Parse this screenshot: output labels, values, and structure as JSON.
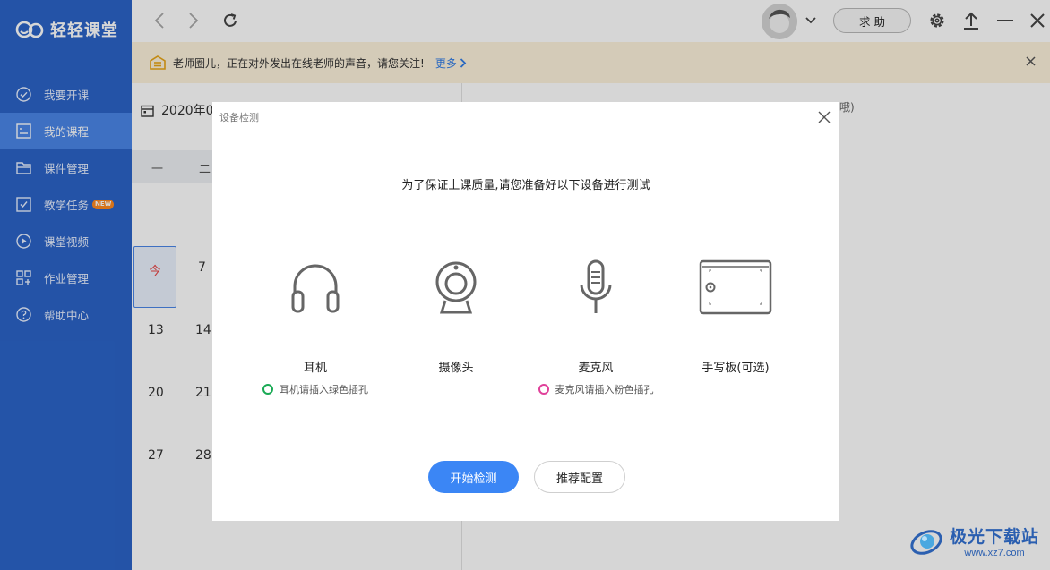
{
  "app": {
    "name": "轻轻课堂"
  },
  "sidebar": {
    "items": [
      {
        "label": "我要开课",
        "icon": "check-circle-icon"
      },
      {
        "label": "我的课程",
        "icon": "course-list-icon",
        "active": true
      },
      {
        "label": "课件管理",
        "icon": "folder-icon"
      },
      {
        "label": "教学任务",
        "icon": "task-check-icon",
        "badge": "NEW"
      },
      {
        "label": "课堂视频",
        "icon": "play-circle-icon"
      },
      {
        "label": "作业管理",
        "icon": "grid-icon"
      },
      {
        "label": "帮助中心",
        "icon": "question-circle-icon"
      }
    ]
  },
  "topbar": {
    "help_label": "求 助"
  },
  "notice": {
    "text": "老师圈儿，正在对外发出在线老师的声音，请您关注!",
    "more_label": "更多"
  },
  "calendar": {
    "month_label": "2020年0",
    "weekdays": [
      "一",
      "二"
    ],
    "today_label": "今",
    "days": [
      "7",
      "13",
      "14",
      "20",
      "21",
      "27",
      "28"
    ]
  },
  "background_hint": "哦)",
  "modal": {
    "title": "设备检测",
    "heading": "为了保证上课质量,请您准备好以下设备进行测试",
    "devices": [
      {
        "label": "耳机",
        "icon": "headphones-icon",
        "hint": "耳机请插入绿色插孔",
        "hint_color": "#1aaa55"
      },
      {
        "label": "摄像头",
        "icon": "webcam-icon",
        "hint": ""
      },
      {
        "label": "麦克风",
        "icon": "microphone-icon",
        "hint": "麦克风请插入粉色插孔",
        "hint_color": "#e0409a"
      },
      {
        "label": "手写板(可选)",
        "icon": "tablet-icon",
        "hint": ""
      }
    ],
    "start_label": "开始检测",
    "recommend_label": "推荐配置"
  },
  "watermark": {
    "title": "极光下载站",
    "url": "www.xz7.com"
  },
  "colors": {
    "sidebar": "#2b64c8",
    "primary": "#3b86f5",
    "notice_bg": "#fdf2dc"
  }
}
